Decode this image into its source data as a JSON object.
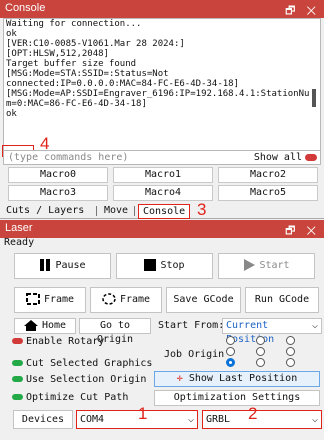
{
  "console_panel": {
    "title": "Console",
    "controls": "🗗 ✕",
    "lines": [
      "Waiting for connection...",
      "ok",
      "[VER:C10-0085-V1061.Mar 28 2024:]",
      "[OPT:HLSW,512,2048]",
      "Target buffer size found",
      "[MSG:Mode=STA:SSID=:Status=Not",
      "connected:IP=0.0.0.0:MAC=84-FC-E6-4D-34-18]",
      "[MSG:Mode=AP:SSDI=Engraver_6196:IP=192.168.4.1:StationNu",
      "m=0:MAC=86-FC-E6-4D-34-18]",
      "ok"
    ],
    "command_placeholder": "(type commands here)",
    "show_all_label": "Show all",
    "macros": [
      "Macro0",
      "Macro1",
      "Macro2",
      "Macro3",
      "Macro4",
      "Macro5"
    ],
    "tabs": [
      "Cuts / Layers",
      "Move",
      "Console"
    ],
    "active_tab": "Console"
  },
  "annotations": [
    "1",
    "2",
    "3",
    "4"
  ],
  "laser_panel": {
    "title": "Laser",
    "controls": "🗗 ✕",
    "status": "Ready",
    "pause_label": "Pause",
    "stop_label": "Stop",
    "start_label": "Start",
    "frame1_label": "Frame",
    "frame2_label": "Frame",
    "save_gcode_label": "Save GCode",
    "run_gcode_label": "Run GCode",
    "home_label": "Home",
    "go_origin_label": "Go to Origin",
    "start_from_label": "Start From:",
    "start_from_value": "Current Position",
    "enable_rotary_label": "Enable Rotary",
    "cut_selected_label": "Cut Selected Graphics",
    "use_selection_origin_label": "Use Selection Origin",
    "optimize_cut_path_label": "Optimize Cut Path",
    "job_origin_label": "Job Origin",
    "show_last_position_label": "Show Last Position",
    "optimization_settings_label": "Optimization Settings",
    "devices_label": "Devices",
    "port_value": "COM4",
    "controller_value": "GRBL"
  },
  "colors": {
    "title_bar": "#c8443c",
    "annotation_red": "#e0241b",
    "toggle_green": "#23a947",
    "toggle_red": "#d23a3a",
    "radio_blue": "#0a73d9"
  }
}
